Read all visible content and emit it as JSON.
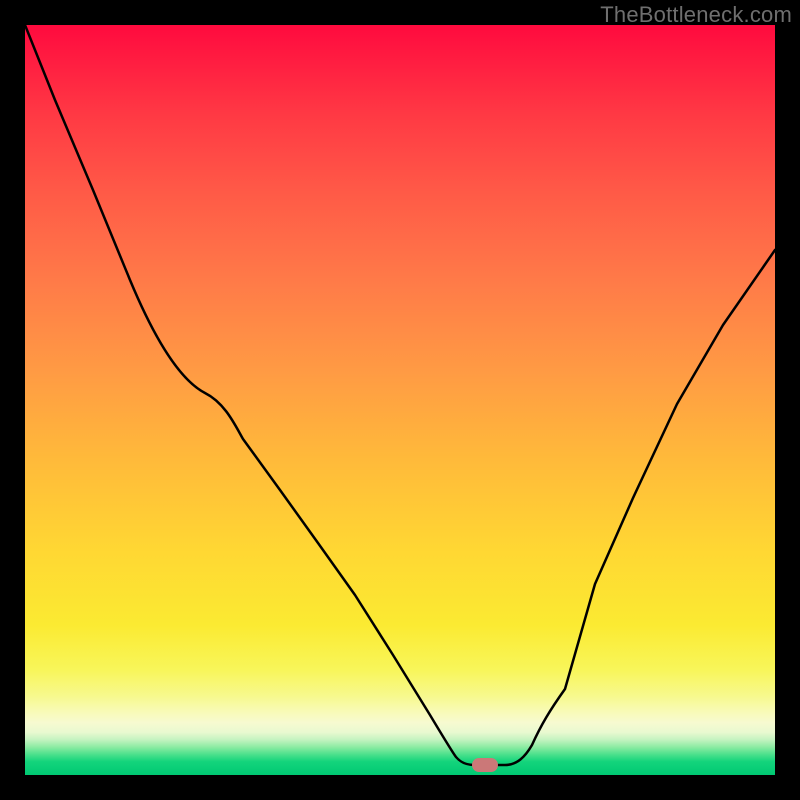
{
  "watermark": "TheBottleneck.com",
  "marker": {
    "x_frac": 0.613,
    "y_frac": 0.986,
    "color": "#cb7878"
  },
  "chart_data": {
    "type": "line",
    "title": "",
    "xlabel": "",
    "ylabel": "",
    "xlim": [
      0,
      1
    ],
    "ylim": [
      0,
      1
    ],
    "background_gradient": {
      "top": "#ff0a3e",
      "mid": "#ffd733",
      "bottom": "#00c973"
    },
    "series": [
      {
        "name": "bottleneck-curve",
        "x": [
          0.0,
          0.04,
          0.09,
          0.14,
          0.19,
          0.24,
          0.29,
          0.34,
          0.39,
          0.44,
          0.49,
          0.54,
          0.575,
          0.6,
          0.64,
          0.69,
          0.72,
          0.76,
          0.81,
          0.87,
          0.93,
          1.0
        ],
        "y": [
          1.0,
          0.9,
          0.78,
          0.66,
          0.56,
          0.51,
          0.448,
          0.38,
          0.31,
          0.24,
          0.16,
          0.08,
          0.025,
          0.015,
          0.015,
          0.08,
          0.155,
          0.255,
          0.37,
          0.495,
          0.6,
          0.7
        ]
      }
    ],
    "annotations": [
      {
        "type": "marker",
        "x": 0.613,
        "y": 0.014,
        "label": "optimal-point"
      }
    ]
  }
}
